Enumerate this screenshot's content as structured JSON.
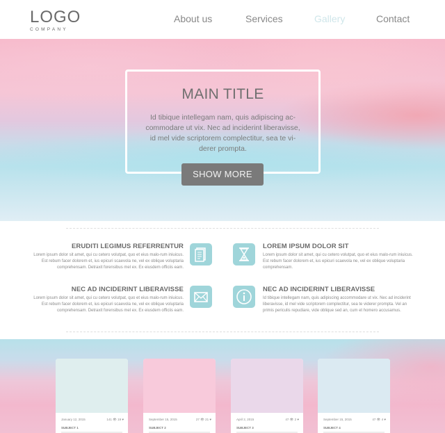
{
  "logo": {
    "main": "LOGO",
    "sub": "COMPANY"
  },
  "nav": [
    {
      "label": "About us",
      "active": false
    },
    {
      "label": "Services",
      "active": false
    },
    {
      "label": "Gallery",
      "active": true
    },
    {
      "label": "Contact",
      "active": false
    }
  ],
  "hero": {
    "title": "MAIN TITLE",
    "text": "Id tibique intellegam nam, quis adipiscing ac-commodare ut vix. Nec ad inciderint liberavisse, id mel vide scriptorem complectitur, sea te vi-derer prompta.",
    "button": "SHOW MORE"
  },
  "features": [
    {
      "title": "ERUDITI LEGIMUS REFERRENTUR",
      "icon": "document-icon",
      "text": "Lorem ipsum dolor sit amet, qui cu cetero volutpat, quo et eius malo-rum iniuicus. Est rebum facer dolorem et, ius epicuri scaevola ne, vel ex oblique voluptaria comprehensam. Detraxit forensibus mel ex. Ex eiusdem officiis eam."
    },
    {
      "title": "LOREM IPSUM DOLOR SIT",
      "icon": "hourglass-icon",
      "text": "Lorem ipsum dolor sit amet, qui cu cetero volutpat, quo et eius malo-rum iniuicus. Est rebum facer dolorem et, ius epicuri scaevola ne, vel ex oblique voluptaria comprehensam."
    },
    {
      "title": "NEC AD INCIDERINT LIBERAVISSE",
      "icon": "envelope-icon",
      "text": "Lorem ipsum dolor sit amet, qui cu cetero volutpat, quo et eius malo-rum iniuicus. Est rebum facer dolorem et, ius epicuri scaevola ne, vel ex oblique voluptaria comprehensam. Detraxit forensibus mel ex. Ex eiusdem officiis eam."
    },
    {
      "title": "NEC AD INCIDERINT LIBERAVISSE",
      "icon": "info-icon",
      "text": "Id tibique intellegam nam, quis adipiscing accommodare ut vix. Nec ad inciderint liberavisse, id mel vide scriptorem complectitur, sea te viderer prompta. Vel an primis periculis repudiare, vide oblique sed an, cum et homero accusamus."
    }
  ],
  "cards": [
    {
      "date": "January 12, 2015",
      "stats": "141 👁 19 ♥",
      "subject": "SUBJECT 1",
      "color": "#dfeeee"
    },
    {
      "date": "September 15, 2015",
      "stats": "27 👁 21 ♥",
      "subject": "SUBJECT 2",
      "color": "#f8cadb"
    },
    {
      "date": "April 2, 2015",
      "stats": "47 👁 2 ♥",
      "subject": "SUBJECT 3",
      "color": "#ead8ea"
    },
    {
      "date": "September 15, 2015",
      "stats": "47 👁 4 ♥",
      "subject": "SUBJECT 4",
      "color": "#dbeaf2"
    }
  ],
  "colors": {
    "accent": "#9fd5da",
    "button": "#7a7a7a",
    "active_nav": "#cfe6ea"
  }
}
